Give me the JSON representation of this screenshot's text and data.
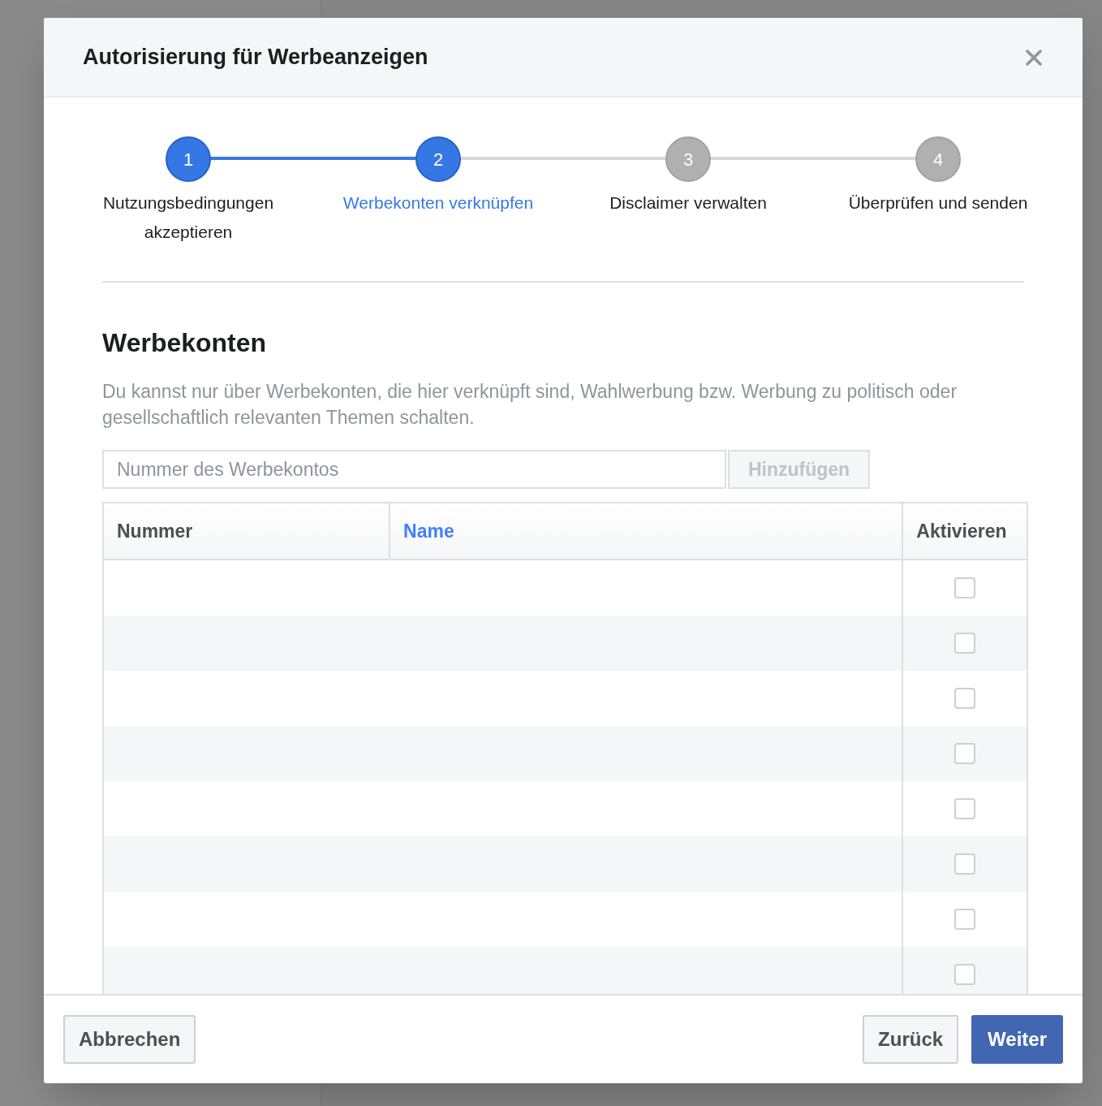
{
  "dialog": {
    "title": "Autorisierung für Werbeanzeigen"
  },
  "steps": [
    {
      "number": "1",
      "label": "Nutzungsbedingungen akzeptieren",
      "reached": true,
      "selected": false
    },
    {
      "number": "2",
      "label": "Werbekonten verknüpfen",
      "reached": true,
      "selected": true
    },
    {
      "number": "3",
      "label": "Disclaimer verwalten",
      "reached": false,
      "selected": false
    },
    {
      "number": "4",
      "label": "Überprüfen und senden",
      "reached": false,
      "selected": false
    }
  ],
  "section": {
    "heading": "Werbekonten",
    "description": "Du kannst nur über Werbekonten, die hier verknüpft sind, Wahlwerbung bzw. Werbung zu politisch oder gesellschaftlich relevanten Themen schalten."
  },
  "account_field": {
    "placeholder": "Nummer des Werbekontos"
  },
  "add_button": {
    "label": "Hinzufügen",
    "disabled": true
  },
  "table": {
    "columns": [
      {
        "label": "Nummer",
        "sorted": false
      },
      {
        "label": "Name",
        "sorted": true
      },
      {
        "label": "Aktivieren",
        "sorted": false
      }
    ],
    "rows": [
      {
        "checked": false
      },
      {
        "checked": false
      },
      {
        "checked": false
      },
      {
        "checked": false
      },
      {
        "checked": false
      },
      {
        "checked": false
      },
      {
        "checked": false
      },
      {
        "checked": false
      }
    ]
  },
  "footer": {
    "cancel": "Abbrechen",
    "back": "Zurück",
    "next": "Weiter"
  }
}
